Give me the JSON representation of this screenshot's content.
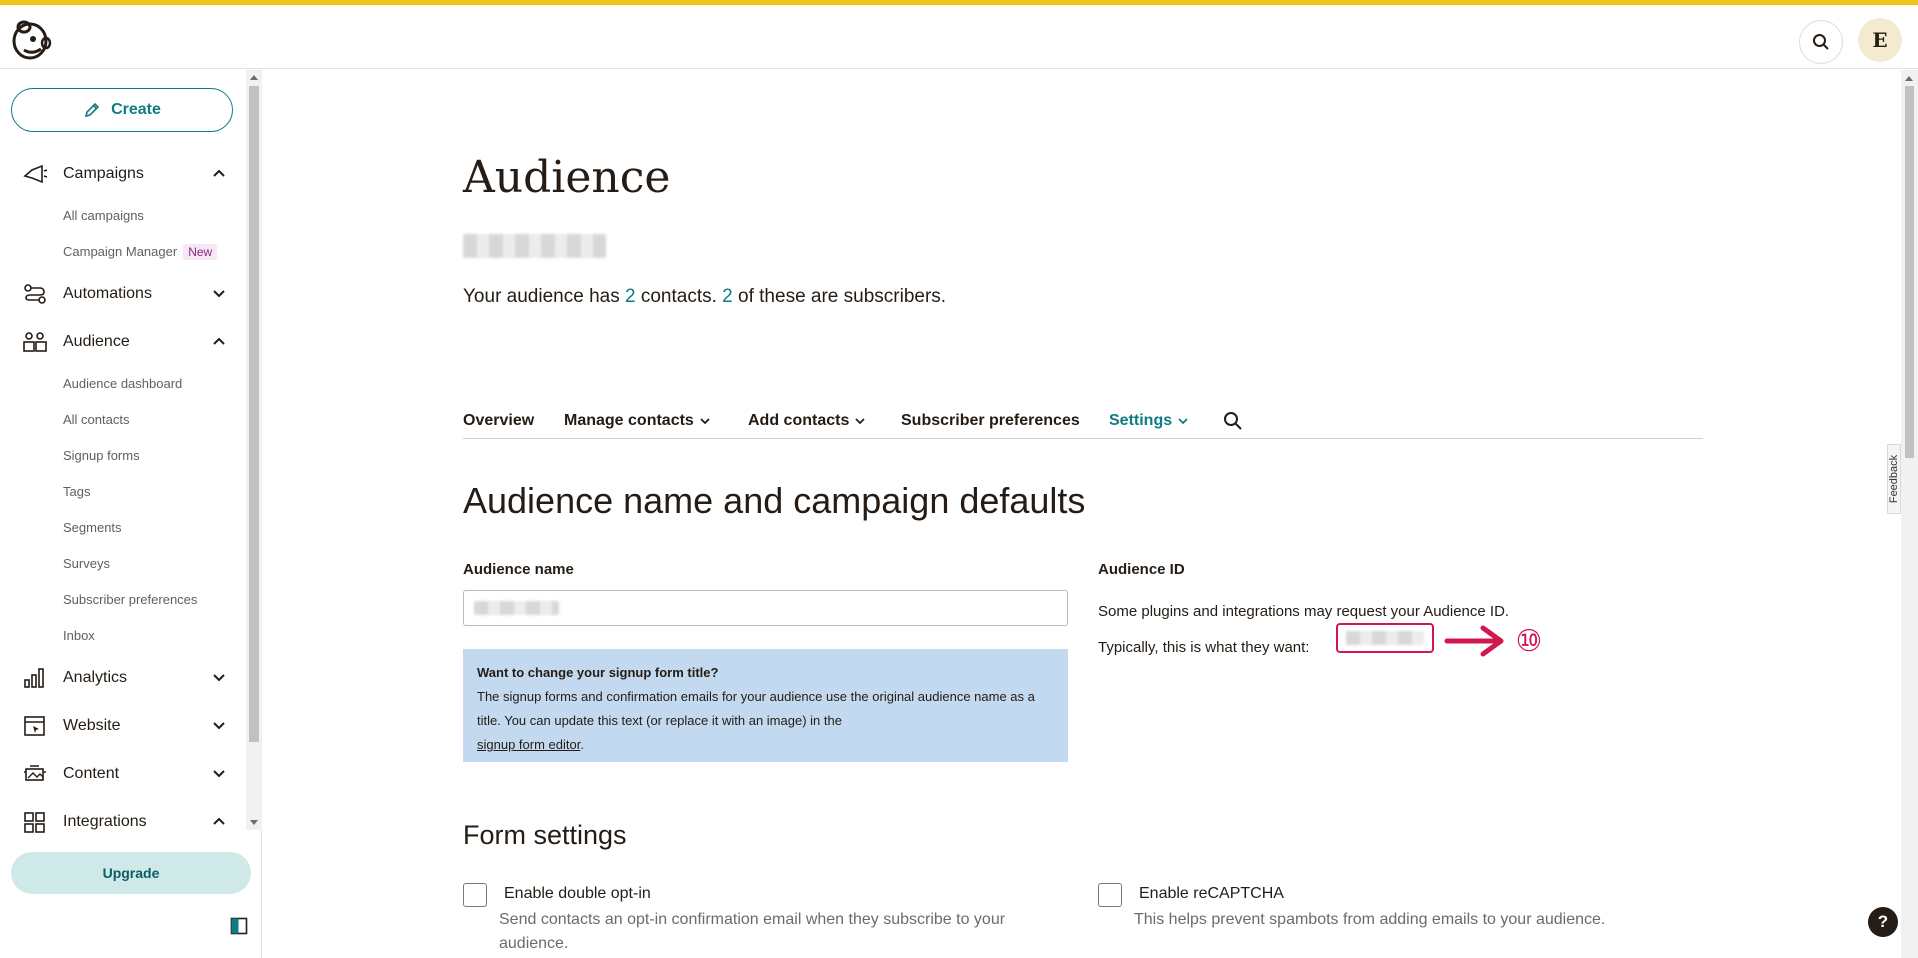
{
  "header": {
    "logo_icon": "mailchimp-freddie-logo-icon",
    "search_icon": "search-icon",
    "avatar_initial": "E"
  },
  "sidebar": {
    "create_label": "Create",
    "sections": [
      {
        "label": "Campaigns",
        "icon": "megaphone-icon",
        "expanded": true,
        "items": [
          "All campaigns",
          "Campaign Manager"
        ],
        "badge": "New"
      },
      {
        "label": "Automations",
        "icon": "automations-icon",
        "expanded": false
      },
      {
        "label": "Audience",
        "icon": "audience-icon",
        "expanded": true,
        "items": [
          "Audience dashboard",
          "All contacts",
          "Signup forms",
          "Tags",
          "Segments",
          "Surveys",
          "Subscriber preferences",
          "Inbox"
        ]
      },
      {
        "label": "Analytics",
        "icon": "bar-chart-icon",
        "expanded": false
      },
      {
        "label": "Website",
        "icon": "website-icon",
        "expanded": false
      },
      {
        "label": "Content",
        "icon": "content-icon",
        "expanded": false
      },
      {
        "label": "Integrations",
        "icon": "grid-icon",
        "expanded": true
      }
    ],
    "upgrade_label": "Upgrade"
  },
  "main": {
    "title": "Audience",
    "stats": {
      "prefix": "Your audience has ",
      "contacts": "2",
      "middle": " contacts. ",
      "subscribers": "2",
      "suffix": " of these are subscribers."
    },
    "tabs": [
      {
        "label": "Overview"
      },
      {
        "label": "Manage contacts",
        "has_dropdown": true
      },
      {
        "label": "Add contacts",
        "has_dropdown": true
      },
      {
        "label": "Subscriber preferences"
      },
      {
        "label": "Settings",
        "has_dropdown": true,
        "active": true
      }
    ],
    "section_title": "Audience name and campaign defaults",
    "audience_name_label": "Audience name",
    "info_box": {
      "title": "Want to change your signup form title?",
      "body": "The signup forms and confirmation emails for your audience use the original audience name as a title. You can update this text (or replace it with an image) in the",
      "link": "signup form editor",
      "end": "."
    },
    "audience_id_label": "Audience ID",
    "audience_id_desc": "Some plugins and integrations may request your Audience ID.",
    "audience_id_want": "Typically, this is what they want: ",
    "annotation_number": "⑩",
    "form_settings_title": "Form settings",
    "double_optin_label": "Enable double opt-in",
    "double_optin_desc": "Send contacts an opt-in confirmation email when they subscribe to your audience.",
    "recaptcha_label": "Enable reCAPTCHA",
    "recaptcha_desc": "This helps prevent spambots from adding emails to your audience.",
    "feedback_label": "Feedback",
    "help_label": "?"
  },
  "colors": {
    "accent": "#0f7b83",
    "highlight": "#d0174e",
    "top_stripe": "#f0c419",
    "info_bg": "#c3d9ef"
  }
}
